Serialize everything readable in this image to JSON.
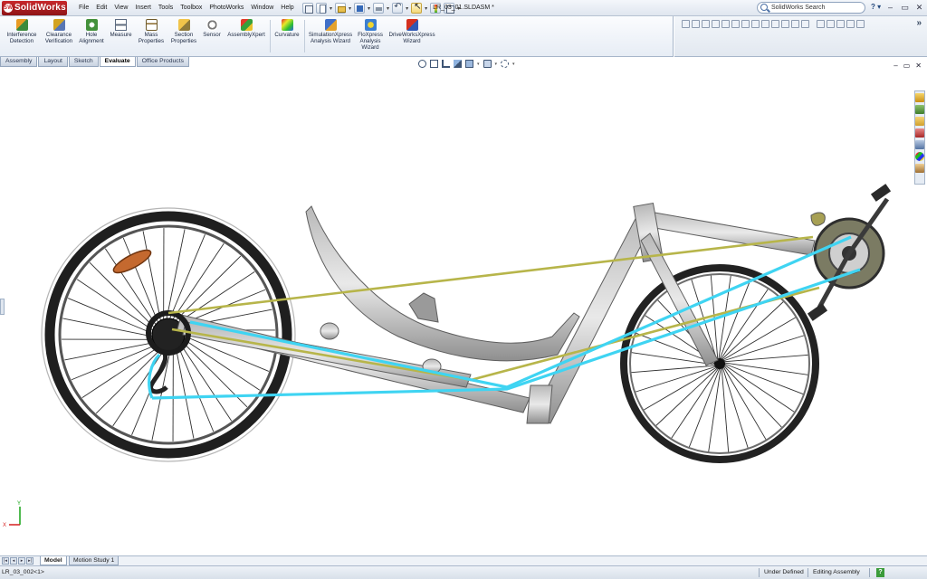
{
  "app": {
    "name": "SolidWorks",
    "document_title": "LR_03_01.SLDASM *"
  },
  "menu": [
    "File",
    "Edit",
    "View",
    "Insert",
    "Tools",
    "Toolbox",
    "PhotoWorks",
    "Window",
    "Help"
  ],
  "search": {
    "placeholder": "SolidWorks Search"
  },
  "help_label": "?",
  "window_controls": {
    "minimize": "–",
    "restore": "▭",
    "close": "✕"
  },
  "commands": [
    {
      "line1": "Interference",
      "line2": "Detection",
      "icon": "interference-detection-icon"
    },
    {
      "line1": "Clearance",
      "line2": "Verification",
      "icon": "clearance-verification-icon"
    },
    {
      "line1": "Hole",
      "line2": "Alignment",
      "icon": "hole-alignment-icon"
    },
    {
      "line1": "Measure",
      "line2": "",
      "icon": "measure-icon"
    },
    {
      "line1": "Mass",
      "line2": "Properties",
      "icon": "mass-properties-icon"
    },
    {
      "line1": "Section",
      "line2": "Properties",
      "icon": "section-properties-icon"
    },
    {
      "line1": "Sensor",
      "line2": "",
      "icon": "sensor-icon"
    },
    {
      "line1": "AssemblyXpert",
      "line2": "",
      "icon": "assemblyxpert-icon"
    },
    {
      "line1": "Curvature",
      "line2": "",
      "icon": "curvature-icon"
    },
    {
      "line1": "SimulationXpress",
      "line2": "Analysis Wizard",
      "line3": "",
      "icon": "simulationxpress-icon"
    },
    {
      "line1": "FloXpress",
      "line2": "Analysis",
      "line3": "Wizard",
      "icon": "floxpress-icon"
    },
    {
      "line1": "DriveWorksXpress",
      "line2": "Wizard",
      "line3": "",
      "icon": "driveworksxpress-icon"
    }
  ],
  "command_tabs": [
    "Assembly",
    "Layout",
    "Sketch",
    "Evaluate",
    "Office Products"
  ],
  "active_command_tab": "Evaluate",
  "chevron": "»",
  "viewport_controls": {
    "minimize": "–",
    "restore": "▭",
    "close": "✕"
  },
  "triad": {
    "x": "X",
    "y": "Y"
  },
  "bottom_tabs": [
    "Model",
    "Motion Study 1"
  ],
  "active_bottom_tab": "Model",
  "status": {
    "component": "LR_03_002<1>",
    "definition": "Under Defined",
    "mode": "Editing Assembly",
    "help": "?"
  },
  "colors": {
    "brand_red": "#c8282c",
    "chain_yellow": "#b7b54a",
    "chain_cyan": "#3fd4f2",
    "frame_grey": "#6e6e6e",
    "tire_dark": "#2a2a2a"
  }
}
